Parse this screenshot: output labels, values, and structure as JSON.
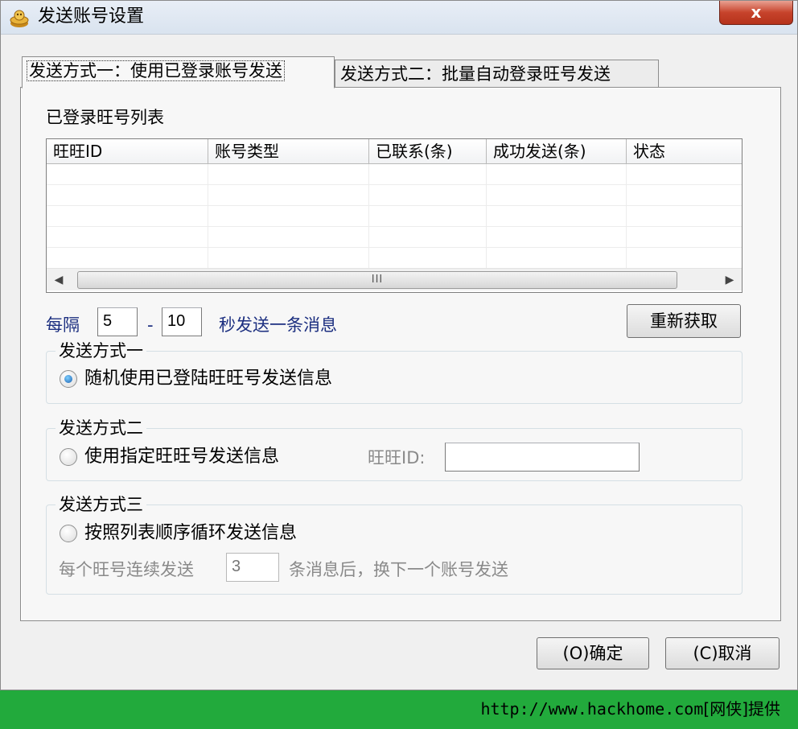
{
  "window": {
    "title": "发送账号设置",
    "close_label": "x"
  },
  "tabs": [
    {
      "label": "发送方式一：使用已登录账号发送",
      "active": true
    },
    {
      "label": "发送方式二：批量自动登录旺号发送",
      "active": false
    }
  ],
  "account_list": {
    "title": "已登录旺号列表",
    "columns": [
      "旺旺ID",
      "账号类型",
      "已联系(条)",
      "成功发送(条)",
      "状态"
    ],
    "rows": [],
    "scroll_grip": "III"
  },
  "interval": {
    "prefix": "每隔",
    "min_value": "5",
    "separator": "-",
    "max_value": "10",
    "suffix": "秒发送一条消息"
  },
  "refresh_button": "重新获取",
  "mode1": {
    "group_title": "发送方式一",
    "radio_label": "随机使用已登陆旺旺号发送信息",
    "checked": true
  },
  "mode2": {
    "group_title": "发送方式二",
    "radio_label": "使用指定旺旺号发送信息",
    "checked": false,
    "id_label": "旺旺ID:",
    "id_value": ""
  },
  "mode3": {
    "group_title": "发送方式三",
    "radio_label": "按照列表顺序循环发送信息",
    "checked": false,
    "each_label": "每个旺号连续发送",
    "count_value": "3",
    "after_label": "条消息后，换下一个账号发送"
  },
  "buttons": {
    "ok": "(O)确定",
    "cancel": "(C)取消"
  },
  "footer": {
    "url": "http://www.hackhome.com",
    "credit": "[网侠]提供"
  },
  "colors": {
    "footer_bg": "#22aa3c",
    "blue_label": "#1c2f80",
    "close_red": "#c7432b"
  }
}
